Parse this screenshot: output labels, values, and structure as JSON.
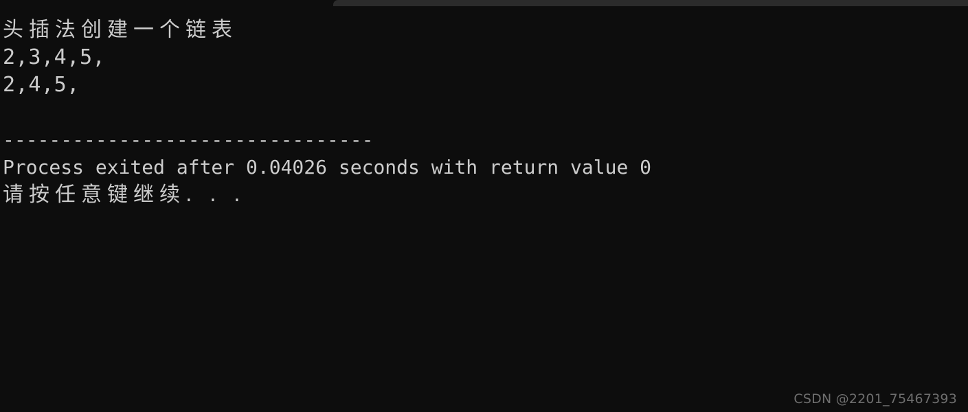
{
  "window": {
    "background_color": "#0d0d0d",
    "text_color": "#cccccc",
    "title_strip_color": "#2b2b2b"
  },
  "console": {
    "lines": [
      {
        "text": "头插法创建一个链表",
        "style": "cjk"
      },
      {
        "text": "2,3,4,5,",
        "style": "mono-wide"
      },
      {
        "text": "2,4,5,",
        "style": "mono-wide"
      },
      {
        "text": "",
        "style": "blank"
      },
      {
        "text": "--------------------------------",
        "style": "rule"
      },
      {
        "text": "Process exited after 0.04026 seconds with return value 0",
        "style": "mono"
      },
      {
        "text": "请按任意键继续. . .",
        "style": "cjk"
      }
    ],
    "line_1": "头插法创建一个链表",
    "line_2": "2,3,4,5,",
    "line_3": "2,4,5,",
    "line_4": "",
    "line_5": "--------------------------------",
    "line_6": "Process exited after 0.04026 seconds with return value 0",
    "line_7": "请按任意键继续. . .",
    "exit_info": {
      "label_prefix": "Process exited after",
      "elapsed_seconds": "0.04026",
      "label_middle": "seconds with return value",
      "return_value": "0"
    },
    "prompt": "请按任意键继续. . ."
  },
  "watermark": {
    "text": "CSDN @2201_75467393",
    "color": "#6e6e6e"
  }
}
